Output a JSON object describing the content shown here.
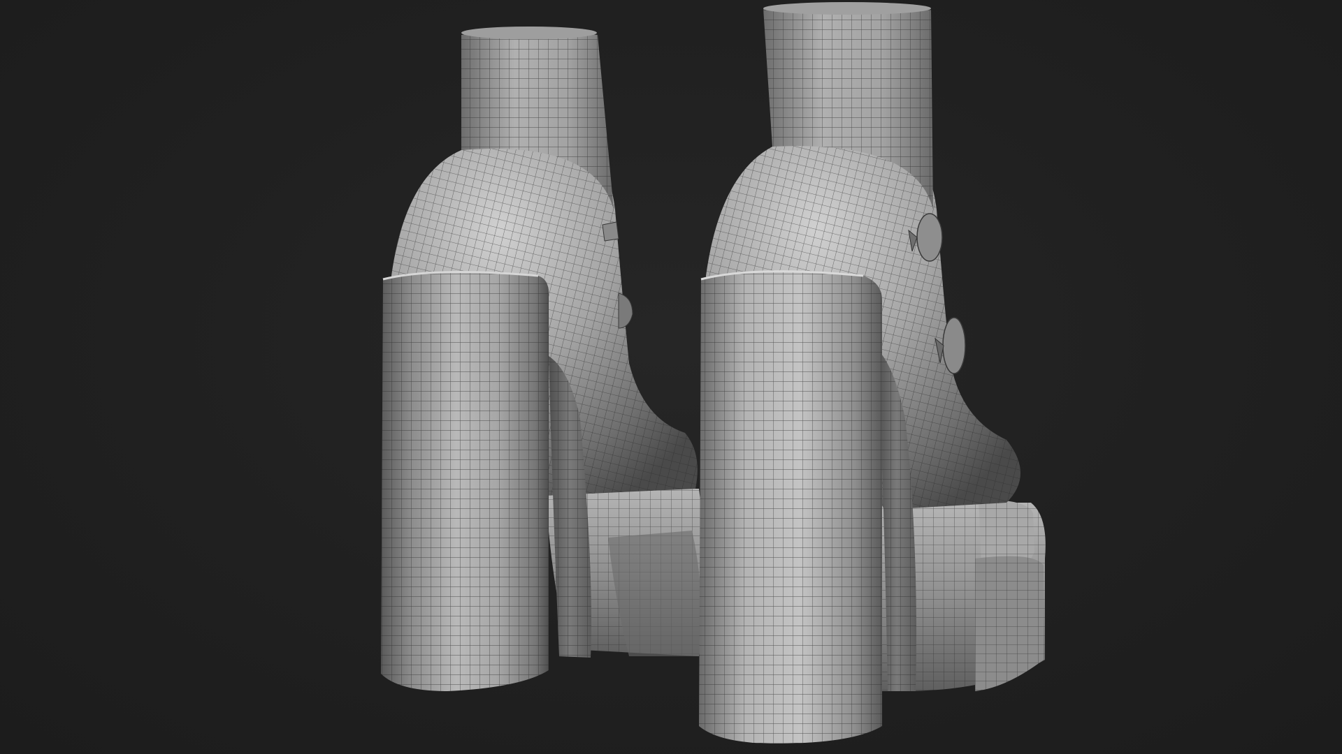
{
  "scene": {
    "background_color": "#1f1f1f",
    "mesh_base_color": "#9a9a9a",
    "mesh_light_color": "#d9d9d9",
    "mesh_dark_color": "#3a3a3a",
    "wireframe_color": "#2a2a2a",
    "objects": [
      "left-boot",
      "right-boot"
    ]
  }
}
